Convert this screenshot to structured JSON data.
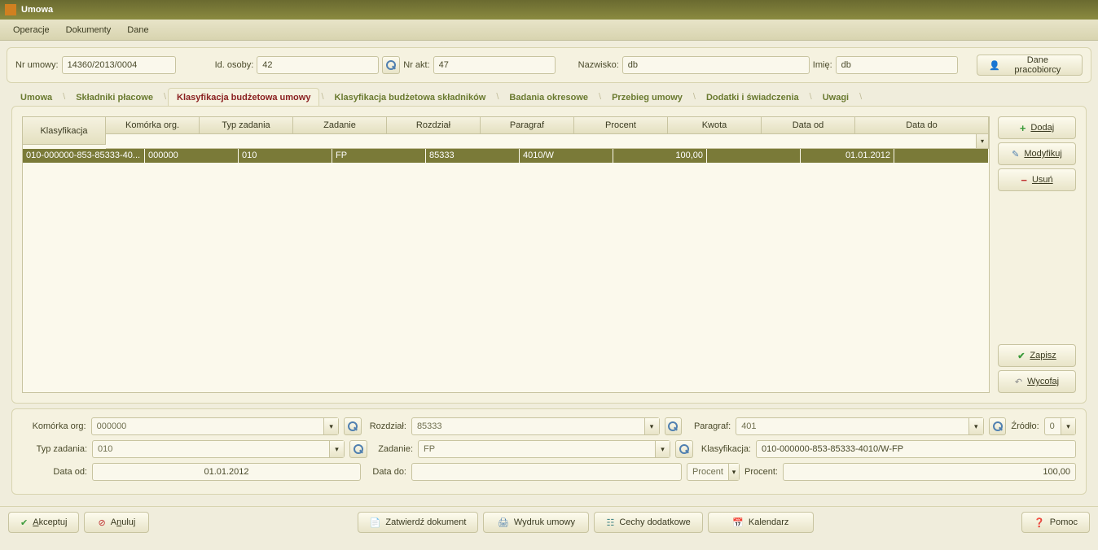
{
  "title": "Umowa",
  "menu": {
    "operacje": "Operacje",
    "dokumenty": "Dokumenty",
    "dane": "Dane"
  },
  "header": {
    "nr_umowy_lbl": "Nr umowy:",
    "nr_umowy": "14360/2013/0004",
    "id_osoby_lbl": "Id. osoby:",
    "id_osoby": "42",
    "nr_akt_lbl": "Nr akt:",
    "nr_akt": "47",
    "nazwisko_lbl": "Nazwisko:",
    "nazwisko": "db",
    "imie_lbl": "Imię:",
    "imie": "db",
    "dane_prac": "Dane pracobiorcy"
  },
  "tabs": {
    "t0": "Umowa",
    "t1": "Składniki płacowe",
    "t2": "Klasyfikacja budżetowa umowy",
    "t3": "Klasyfikacja budżetowa składników",
    "t4": "Badania okresowe",
    "t5": "Przebieg umowy",
    "t6": "Dodatki i świadczenia",
    "t7": "Uwagi"
  },
  "cols": {
    "klasyfikacja": "Klasyfikacja",
    "komorka": "Komórka org.",
    "typ": "Typ zadania",
    "zadanie": "Zadanie",
    "rozdzial": "Rozdział",
    "paragraf": "Paragraf",
    "procent": "Procent",
    "kwota": "Kwota",
    "dataod": "Data od",
    "datado": "Data do"
  },
  "row": {
    "klasyfikacja": "010-000000-853-85333-40...",
    "komorka": "000000",
    "typ": "010",
    "zadanie": "FP",
    "rozdzial": "85333",
    "paragraf": "4010/W",
    "procent": "100,00",
    "kwota": "",
    "dataod": "01.01.2012",
    "datado": ""
  },
  "side": {
    "dodaj": "Dodaj",
    "modyfikuj": "Modyfikuj",
    "usun": "Usuń",
    "zapisz": "Zapisz",
    "wycofaj": "Wycofaj"
  },
  "detail": {
    "komorka_lbl": "Komórka org:",
    "komorka": "000000",
    "rozdzial_lbl": "Rozdział:",
    "rozdzial": "85333",
    "paragraf_lbl": "Paragraf:",
    "paragraf": "401",
    "zrodlo_lbl": "Źródło:",
    "zrodlo": "0",
    "typ_lbl": "Typ zadania:",
    "typ": "010",
    "zadanie_lbl": "Zadanie:",
    "zadanie": "FP",
    "klas_lbl": "Klasyfikacja:",
    "klas": "010-000000-853-85333-4010/W-FP",
    "dataod_lbl": "Data od:",
    "dataod": "01.01.2012",
    "datado_lbl": "Data do:",
    "datado": "",
    "procent_sel": "Procent",
    "procent_lbl": "Procent:",
    "procent": "100,00"
  },
  "footer": {
    "akceptuj": "Akceptuj",
    "anuluj": "Anuluj",
    "zatwierdz": "Zatwierdź dokument",
    "wydruk": "Wydruk umowy",
    "cechy": "Cechy dodatkowe",
    "kalendarz": "Kalendarz",
    "pomoc": "Pomoc"
  }
}
